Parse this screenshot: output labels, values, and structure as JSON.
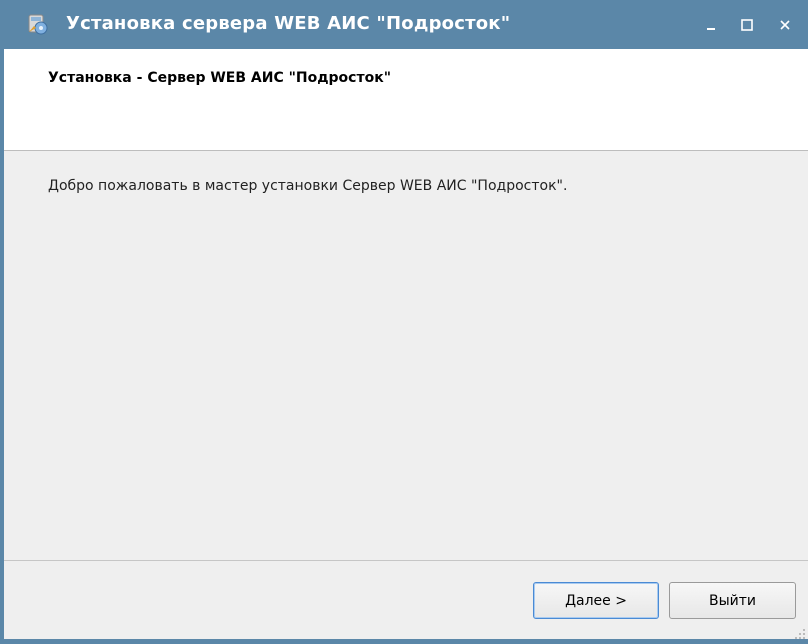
{
  "window": {
    "title": "Установка сервера WEB АИС \"Подросток\"",
    "icon": "installer-icon",
    "controls": {
      "minimize": "minimize-icon",
      "maximize": "maximize-icon",
      "close": "close-icon"
    }
  },
  "header": {
    "title": "Установка - Сервер WEB АИС \"Подросток\""
  },
  "main": {
    "welcome_text": "Добро пожаловать в мастер установки Сервер WEB АИС \"Подросток\"."
  },
  "buttons": {
    "next_label": "Далее >",
    "exit_label": "Выйти"
  },
  "colors": {
    "titlebar": "#5b87a8",
    "client_bg": "#efefef",
    "header_bg": "#ffffff",
    "focus_border": "#4a8ad4"
  }
}
